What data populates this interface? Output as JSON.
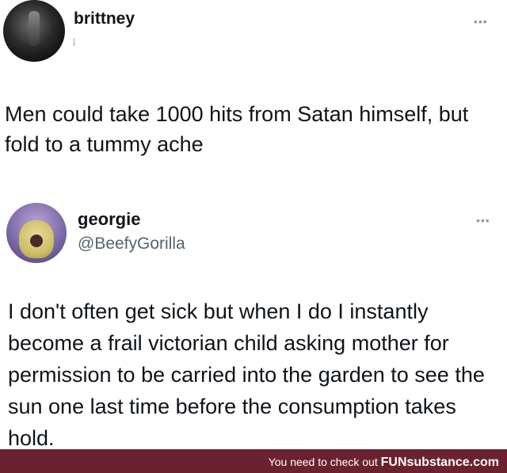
{
  "tweets": [
    {
      "display_name": "brittney",
      "handle": "",
      "text": "Men could take 1000 hits from Satan himself, but fold to a tummy ache",
      "more_icon": "more-dots-icon"
    },
    {
      "display_name": "georgie",
      "handle": "@BeefyGorilla",
      "text": "I don't often get sick but when I do I instantly become a frail victorian child asking mother for permission to be carried into the garden to see the sun one last time before the consumption takes hold.",
      "more_icon": "more-dots-icon"
    }
  ],
  "footer": {
    "text": "You need to check out ",
    "brand": "FUNsubstance.com",
    "color": "#6b2230"
  }
}
